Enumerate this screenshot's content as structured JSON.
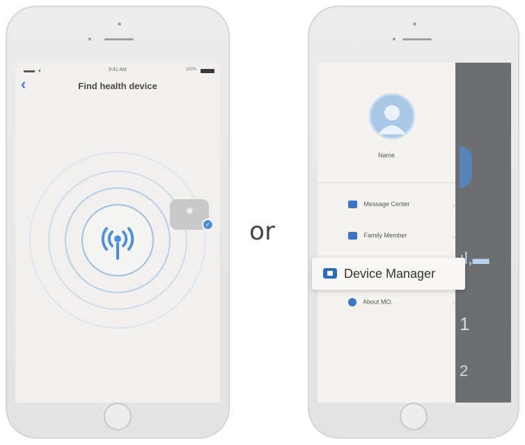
{
  "left_phone": {
    "nav_title": "Find health device",
    "back_icon": "chevron-left-icon",
    "signal_icon": "broadcast-icon",
    "check_icon": "check-icon"
  },
  "separator": "or",
  "right_phone": {
    "profile_name": "Name",
    "menu": [
      {
        "label": "Message Center",
        "icon": "message-icon"
      },
      {
        "label": "Family Member",
        "icon": "family-icon"
      },
      {
        "label": "About MO.",
        "icon": "info-icon"
      }
    ],
    "highlighted_item": {
      "label": "Device Manager",
      "icon": "device-icon"
    }
  },
  "colors": {
    "accent": "#3b7fd1",
    "ring": "#a9c7e6",
    "overlay": "#6d6e71"
  }
}
